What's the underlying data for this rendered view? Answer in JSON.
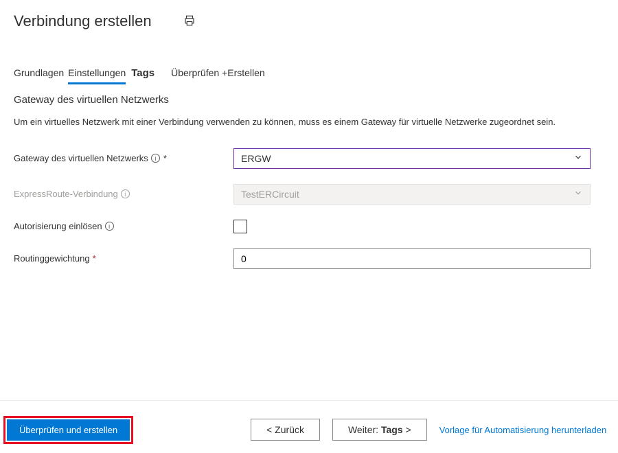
{
  "header": {
    "title": "Verbindung erstellen"
  },
  "tabs": {
    "basics": "Grundlagen",
    "settings": "Einstellungen",
    "tags": "Tags",
    "review": "Überprüfen +Erstellen"
  },
  "section": {
    "title": "Gateway des virtuellen Netzwerks",
    "desc": "Um ein virtuelles Netzwerk mit einer Verbindung verwenden zu können, muss es einem Gateway für virtuelle Netzwerke zugeordnet sein."
  },
  "fields": {
    "gateway": {
      "label": "Gateway des virtuellen Netzwerks",
      "required": "*",
      "value": "ERGW"
    },
    "expressroute": {
      "label": "ExpressRoute-Verbindung",
      "value": "TestERCircuit"
    },
    "auth": {
      "label": "Autorisierung einlösen"
    },
    "routing": {
      "label": "Routinggewichtung",
      "required": "*",
      "value": "0"
    }
  },
  "footer": {
    "review_create": "Überprüfen und erstellen",
    "back": "<  Zurück",
    "next_prefix": "Weiter: ",
    "next_bold": "Tags",
    "next_suffix": " >",
    "download": "Vorlage für Automatisierung herunterladen"
  }
}
